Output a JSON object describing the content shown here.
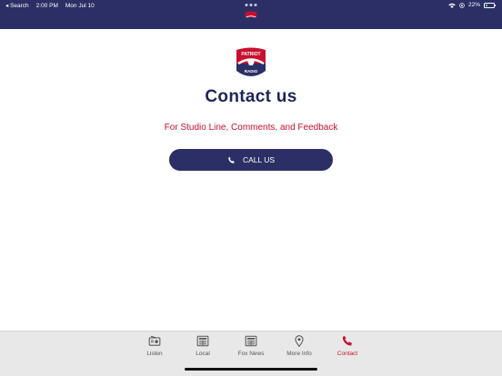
{
  "status_bar": {
    "back_label": "◂ Search",
    "time": "2:00 PM",
    "date": "Mon Jul 10",
    "battery": "22%"
  },
  "logo": {
    "top_text": "PATRIOT",
    "bottom_text": "RADIO",
    "colors": {
      "red": "#c8102e",
      "navy": "#2b2f66"
    }
  },
  "page": {
    "title": "Contact us",
    "subtitle": "For Studio Line, Comments, and Feedback",
    "call_button_label": "CALL US"
  },
  "tabs": [
    {
      "label": "Listen",
      "icon": "radio-icon",
      "active": false
    },
    {
      "label": "Local",
      "icon": "newspaper-icon",
      "active": false
    },
    {
      "label": "Fox News",
      "icon": "newspaper-icon",
      "active": false
    },
    {
      "label": "More Info",
      "icon": "map-pin-icon",
      "active": false
    },
    {
      "label": "Contact",
      "icon": "phone-icon",
      "active": true
    }
  ],
  "colors": {
    "header_bg": "#2b2f66",
    "accent": "#c8102e",
    "title": "#1e2557",
    "tabbar_bg": "#e8e8e9"
  }
}
